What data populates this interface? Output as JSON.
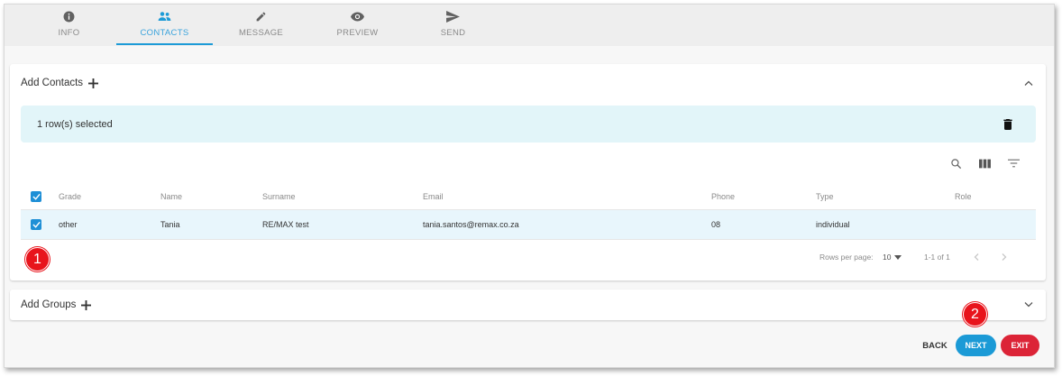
{
  "tabs": [
    {
      "label": "INFO",
      "icon": "info-icon"
    },
    {
      "label": "CONTACTS",
      "icon": "people-icon",
      "active": true
    },
    {
      "label": "MESSAGE",
      "icon": "pencil-icon"
    },
    {
      "label": "PREVIEW",
      "icon": "eye-icon"
    },
    {
      "label": "SEND",
      "icon": "send-icon"
    }
  ],
  "contacts_panel": {
    "title": "Add Contacts",
    "selected_text": "1 row(s) selected",
    "columns": [
      "Grade",
      "Name",
      "Surname",
      "Email",
      "Phone",
      "Type",
      "Role"
    ],
    "rows": [
      {
        "grade": "other",
        "name": "Tania",
        "surname": "RE/MAX test",
        "email": "tania.santos@remax.co.za",
        "phone": "08",
        "type": "individual",
        "role": ""
      }
    ],
    "pagination": {
      "rows_per_page_label": "Rows per page:",
      "rows_per_page_value": "10",
      "range": "1-1 of 1"
    }
  },
  "groups_panel": {
    "title": "Add Groups"
  },
  "markers": {
    "one": "1",
    "two": "2"
  },
  "actions": {
    "back": "BACK",
    "next": "NEXT",
    "exit": "EXIT"
  },
  "colors": {
    "accent": "#1b9ad6",
    "exit": "#dc2437",
    "selected_bg": "#e2f5f9",
    "marker": "#e8141c"
  }
}
